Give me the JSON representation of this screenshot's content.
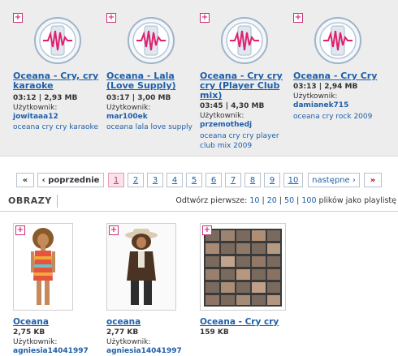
{
  "audio": {
    "add_symbol": "+",
    "user_label": "Użytkownik:",
    "items": [
      {
        "title": "Oceana - Cry, cry karaoke",
        "duration": "03:12",
        "size": "2,93 MB",
        "user": "jowitaaa12",
        "tags": "oceana cry cry karaoke"
      },
      {
        "title": "Oceana - Lala (Love Supply)",
        "duration": "03:17",
        "size": "3,00 MB",
        "user": "mar100ek",
        "tags": "oceana lala love supply"
      },
      {
        "title": "Oceana - Cry cry cry (Player Club mix)",
        "duration": "03:45",
        "size": "4,30 MB",
        "user": "przemothedj",
        "tags": "oceana cry cry player club mix 2009"
      },
      {
        "title": "Oceana - Cry Cry",
        "duration": "03:13",
        "size": "2,94 MB",
        "user": "damianek715",
        "tags": "oceana cry rock 2009"
      }
    ]
  },
  "pager": {
    "first": "«",
    "prev": "‹ poprzednie",
    "pages": [
      "1",
      "2",
      "3",
      "4",
      "5",
      "6",
      "7",
      "8",
      "9",
      "10"
    ],
    "active_page": "1",
    "next": "następne ›",
    "last": "»"
  },
  "images": {
    "tab_label": "OBRAZY",
    "open_first_label": "Odtwórz pierwsze:",
    "open_counts": [
      "10",
      "20",
      "50",
      "100"
    ],
    "open_suffix": "plików jako playlistę",
    "add_symbol": "+",
    "user_label": "Użytkownik:",
    "items": [
      {
        "title": "Oceana",
        "size": "2,75 KB",
        "user": "agniesia14041997"
      },
      {
        "title": "oceana",
        "size": "2,77 KB",
        "user": "agniesia14041997"
      },
      {
        "title": "Oceana - Cry cry",
        "size": "159 KB",
        "user": ""
      }
    ]
  },
  "colors": {
    "link": "#1f5fa8",
    "accent": "#cc3377",
    "panel": "#ededed"
  }
}
